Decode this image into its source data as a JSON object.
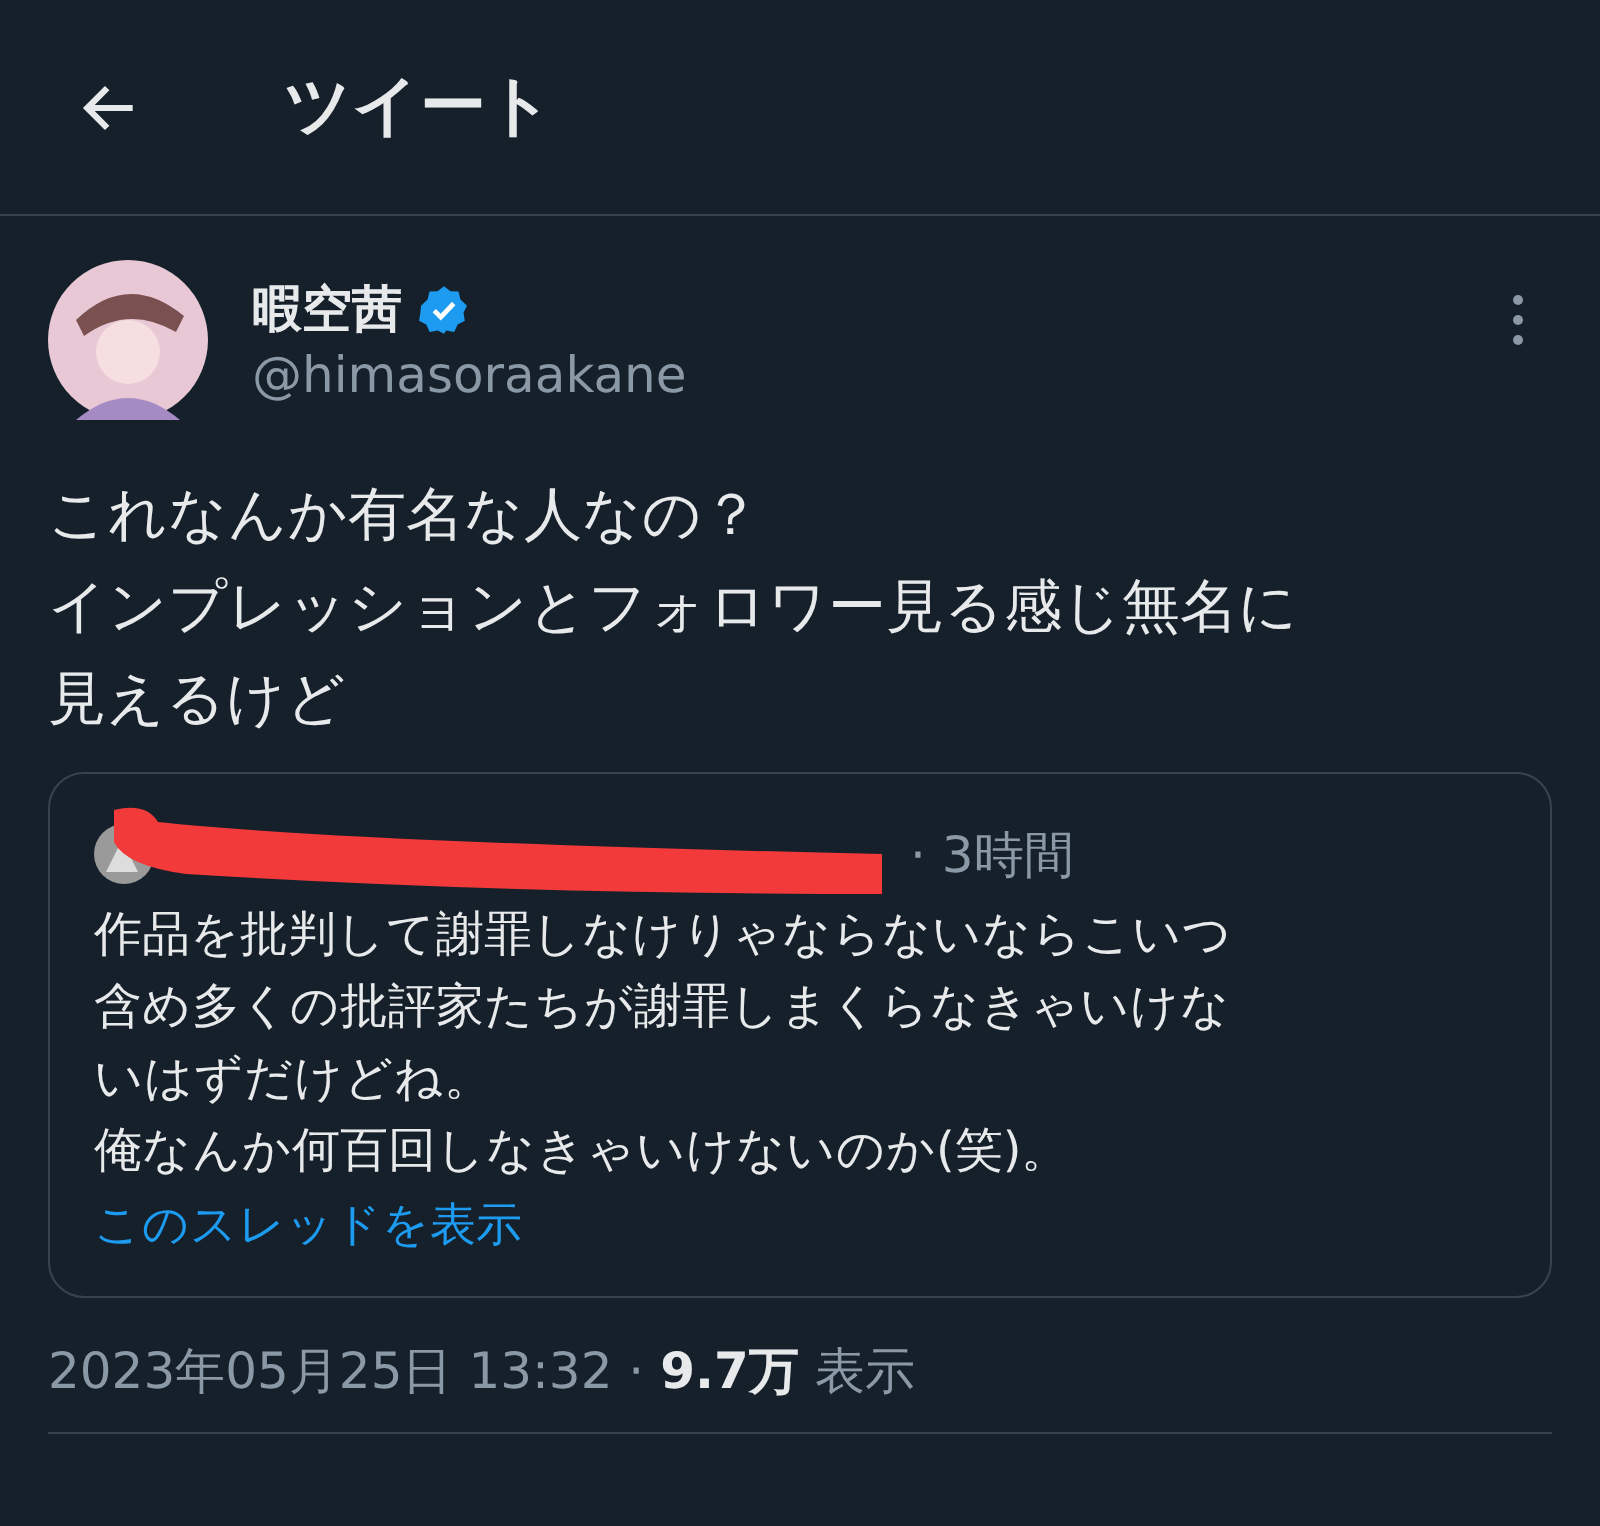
{
  "header": {
    "title": "ツイート"
  },
  "tweet": {
    "author": {
      "name": "暇空茜",
      "verified": true,
      "handle": "@himasoraakane"
    },
    "lines": [
      "これなんか有名な人なの？",
      "インプレッションとフォロワー見る感じ無名に",
      "見えるけど"
    ],
    "quote": {
      "redacted": true,
      "time": "· 3時間",
      "lines": [
        "作品を批判して謝罪しなけりゃならないならこいつ",
        "含め多くの批評家たちが謝罪しまくらなきゃいけな",
        "いはずだけどね。",
        "俺なんか何百回しなきゃいけないのか(笑)。"
      ],
      "link": "このスレッドを表示"
    },
    "timestamp": "2023年05月25日 13:32 ·",
    "views": "9.7万",
    "views_label": "表示"
  }
}
